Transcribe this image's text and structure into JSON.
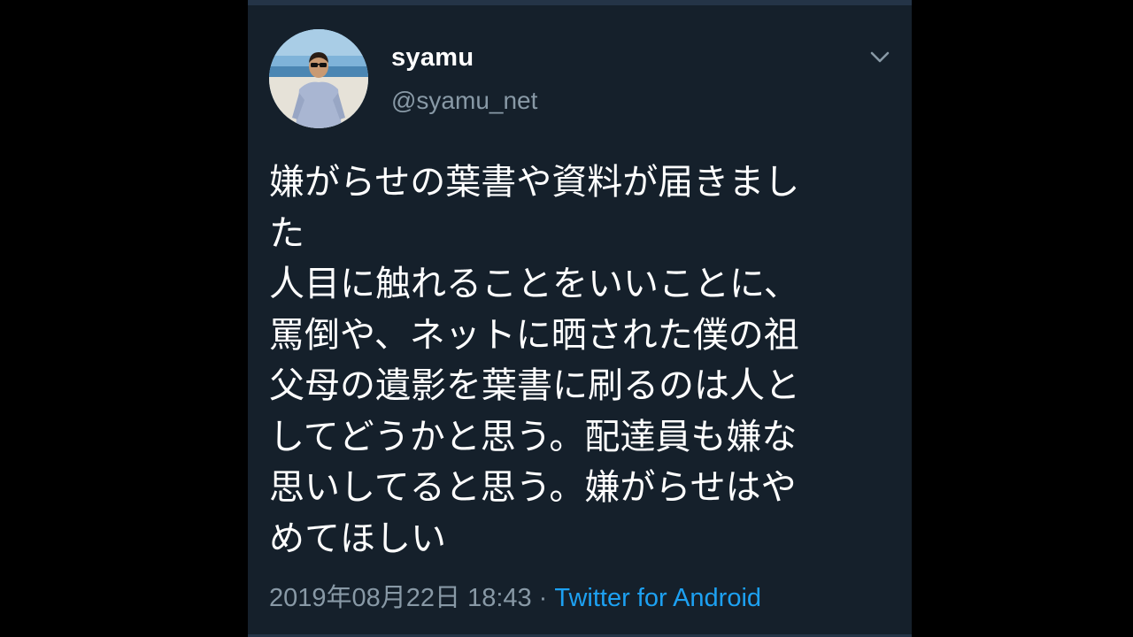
{
  "tweet": {
    "display_name": "syamu",
    "handle": "@syamu_net",
    "text": "嫌がらせの葉書や資料が届きまし\nた\n人目に触れることをいいことに、\n罵倒や、ネットに晒された僕の祖\n父母の遺影を葉書に刷るのは人と\nしてどうかと思う。配達員も嫌な\n思いしてると思う。嫌がらせはや\nめてほしい",
    "timestamp": "2019年08月22日 18:43",
    "separator": "·",
    "source": "Twitter for Android",
    "menu_icon": "chevron-down-icon",
    "avatar_icon": "profile-photo"
  },
  "colors": {
    "background": "#15202b",
    "text": "#ffffff",
    "secondary_text": "#8899a6",
    "link": "#1da1f2"
  }
}
